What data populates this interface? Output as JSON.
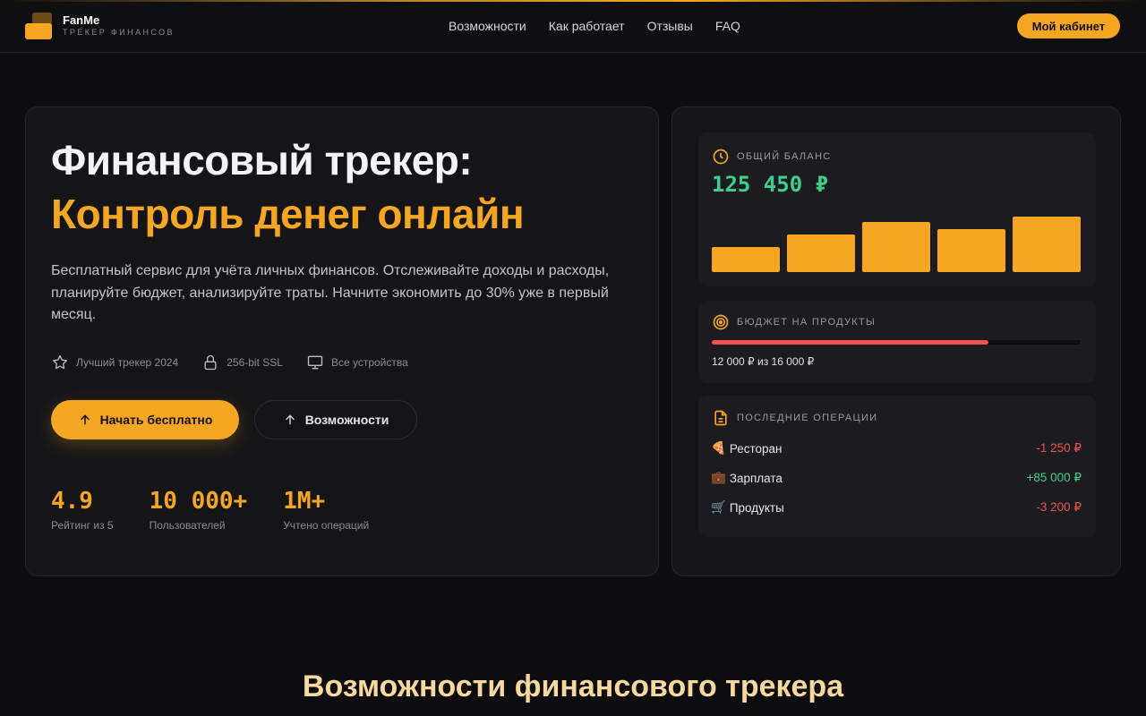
{
  "header": {
    "brand_name": "FanMe",
    "brand_tagline": "ТРЕКЕР ФИНАНСОВ",
    "nav": [
      "Возможности",
      "Как работает",
      "Отзывы",
      "FAQ"
    ],
    "cabinet_label": "Мой кабинет"
  },
  "hero": {
    "title_line1": "Финансовый трекер:",
    "title_line2": "Контроль денег онлайн",
    "description": "Бесплатный сервис для учёта личных финансов. Отслеживайте доходы и расходы, планируйте бюджет, анализируйте траты. Начните экономить до 30% уже в первый месяц.",
    "features": [
      {
        "icon": "star-icon",
        "label": "Лучший трекер 2024"
      },
      {
        "icon": "lock-icon",
        "label": "256-bit SSL"
      },
      {
        "icon": "monitor-icon",
        "label": "Все устройства"
      }
    ],
    "primary_button": "Начать бесплатно",
    "secondary_button": "Возможности",
    "stats": [
      {
        "value": "4.9",
        "label": "Рейтинг из 5"
      },
      {
        "value": "10 000+",
        "label": "Пользователей"
      },
      {
        "value": "1M+",
        "label": "Учтено операций"
      }
    ]
  },
  "dashboard": {
    "balance": {
      "label": "ОБЩИЙ БАЛАНС",
      "value": "125 450 ₽",
      "bar_levels": [
        0.45,
        0.67,
        0.9,
        0.78,
        1.0
      ]
    },
    "budget": {
      "label": "БЮДЖЕТ НА ПРОДУКТЫ",
      "text": "12 000 ₽ из 16 000 ₽",
      "progress": 0.75
    },
    "operations": {
      "label": "ПОСЛЕДНИЕ ОПЕРАЦИИ",
      "items": [
        {
          "emoji": "🍕",
          "name": "Ресторан",
          "amount": "-1 250 ₽",
          "type": "neg"
        },
        {
          "emoji": "💼",
          "name": "Зарплата",
          "amount": "+85 000 ₽",
          "type": "pos"
        },
        {
          "emoji": "🛒",
          "name": "Продукты",
          "amount": "-3 200 ₽",
          "type": "neg"
        }
      ]
    }
  },
  "section": {
    "title": "Возможности финансового трекера"
  },
  "colors": {
    "accent": "#f5a623",
    "positive": "#3ecf8e",
    "negative": "#f05252",
    "background": "#0d0d0f"
  }
}
